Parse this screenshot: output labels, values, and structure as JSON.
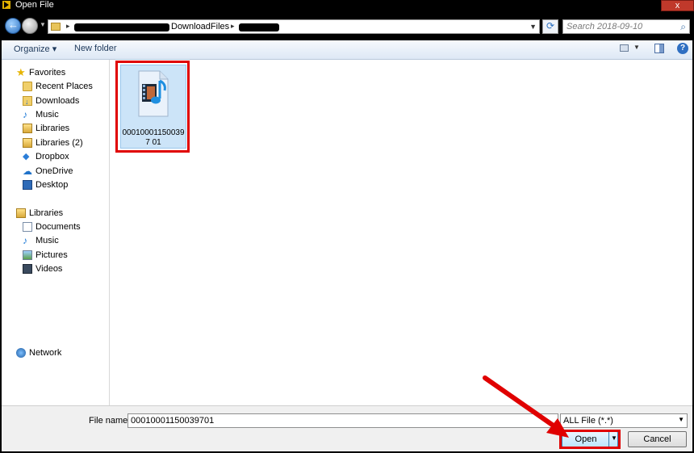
{
  "window": {
    "title": "Open File",
    "close_glyph": "x"
  },
  "address_bar": {
    "breadcrumb_folder": "DownloadFiles",
    "search_placeholder": "Search 2018-09-10"
  },
  "toolbar": {
    "organize_label": "Organize ▾",
    "new_folder_label": "New folder",
    "help_glyph": "?"
  },
  "nav_pane": {
    "favorites_header": "Favorites",
    "favorites": [
      "Recent Places",
      "Downloads",
      "Music",
      "Libraries",
      "Libraries (2)",
      "Dropbox",
      "OneDrive",
      "Desktop"
    ],
    "libraries_header": "Libraries",
    "libraries": [
      "Documents",
      "Music",
      "Pictures",
      "Videos"
    ],
    "network_label": "Network"
  },
  "files": [
    {
      "name": "000100011500397 01",
      "type": "media-file-icon",
      "selected": true
    }
  ],
  "bottom": {
    "file_name_label": "File name:",
    "file_name_value": "00010001150039701",
    "file_type_value": "ALL File (*.*)",
    "open_label": "Open",
    "cancel_label": "Cancel"
  },
  "colors": {
    "highlight_red": "#e00000",
    "selection_blue": "#cce4f8",
    "toolbar_text": "#1e395b"
  }
}
